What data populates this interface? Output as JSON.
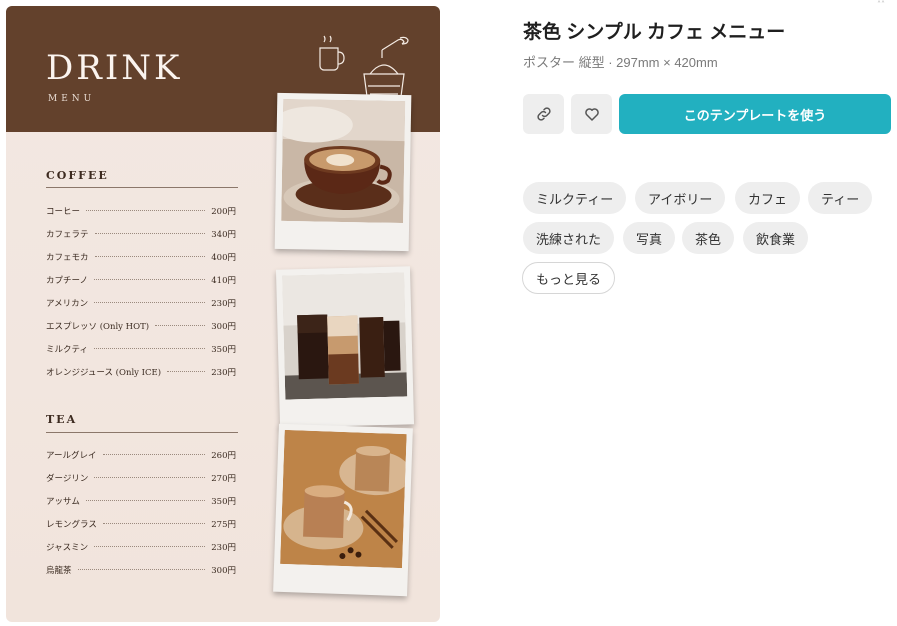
{
  "template": {
    "title": "茶色 シンプル カフェ メニュー",
    "subtitle": "ポスター 縦型 · 297mm × 420mm",
    "use_button_label": "このテンプレートを使う",
    "accent_color": "#22b0c0"
  },
  "actions": {
    "link_icon": "link-icon",
    "favorite_icon": "heart-icon"
  },
  "tags": [
    "ミルクティー",
    "アイボリー",
    "カフェ",
    "ティー",
    "洗練された",
    "写真",
    "茶色",
    "飲食業"
  ],
  "more_label": "もっと見る",
  "poster": {
    "header_color": "#63412c",
    "title": "DRINK",
    "subtitle": "MENU",
    "coffee": {
      "heading": "COFFEE",
      "items": [
        {
          "name": "コーヒー",
          "price": "200円"
        },
        {
          "name": "カフェラテ",
          "price": "340円"
        },
        {
          "name": "カフェモカ",
          "price": "400円"
        },
        {
          "name": "カプチーノ",
          "price": "410円"
        },
        {
          "name": "アメリカン",
          "price": "230円"
        },
        {
          "name": "エスプレッソ (Only HOT)",
          "price": "300円"
        },
        {
          "name": "ミルクティ",
          "price": "350円"
        },
        {
          "name": "オレンジジュース (Only ICE)",
          "price": "230円"
        }
      ]
    },
    "tea": {
      "heading": "TEA",
      "items": [
        {
          "name": "アールグレイ",
          "price": "260円"
        },
        {
          "name": "ダージリン",
          "price": "270円"
        },
        {
          "name": "アッサム",
          "price": "350円"
        },
        {
          "name": "レモングラス",
          "price": "275円"
        },
        {
          "name": "ジャスミン",
          "price": "230円"
        },
        {
          "name": "烏龍茶",
          "price": "300円"
        }
      ]
    },
    "photos": [
      "latte-art-photo",
      "iced-coffee-photo",
      "milk-tea-photo"
    ]
  }
}
